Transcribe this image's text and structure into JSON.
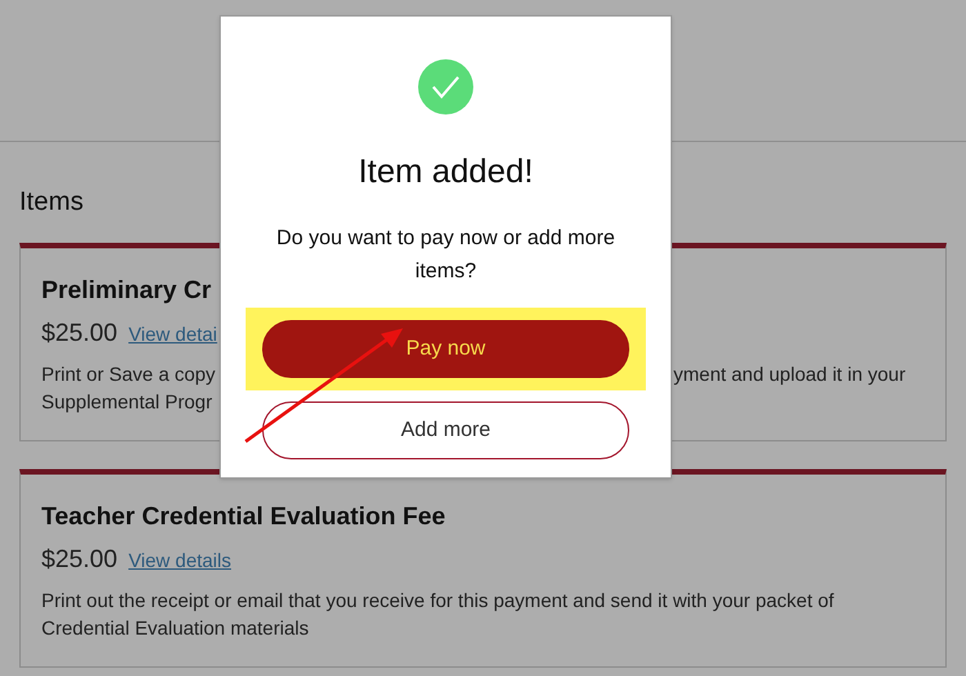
{
  "section_title": "Items",
  "cards": [
    {
      "title": "Preliminary Cr",
      "price": "$25.00",
      "link": "View detai",
      "text_left": [
        "Print or Save a copy",
        "Supplemental Progr"
      ],
      "text_right": "yment and upload it in your"
    },
    {
      "title": "Teacher Credential Evaluation Fee",
      "price": "$25.00",
      "link": "View details",
      "text_left": [
        "Print out the receipt or email that you receive for this payment and send it with your packet of",
        "Credential Evaluation materials"
      ]
    }
  ],
  "dialog": {
    "title": "Item added!",
    "message": "Do you want to pay now or add more items?",
    "buttons": [
      {
        "label": "Pay now",
        "kind": "primary",
        "highlighted": true
      },
      {
        "label": "Add more",
        "kind": "outline",
        "highlighted": false
      }
    ]
  }
}
